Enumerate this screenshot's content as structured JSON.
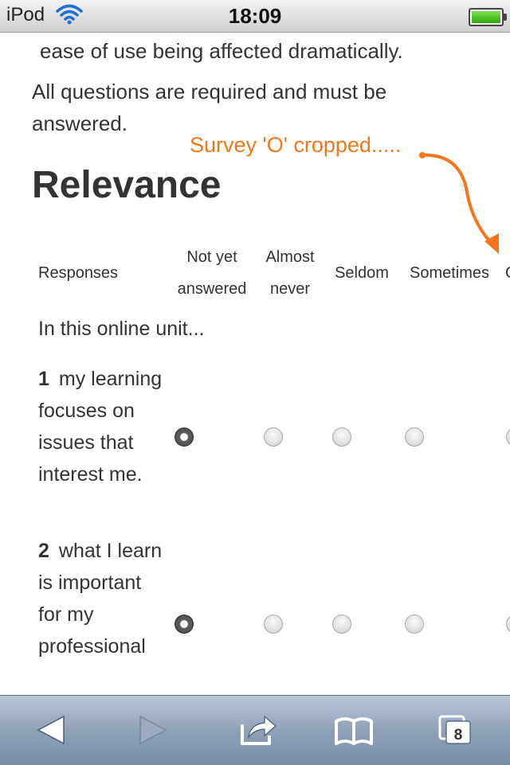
{
  "status_bar": {
    "device": "iPod",
    "time": "18:09"
  },
  "page": {
    "paragraph1_tail": "ease of use being affected dramatically.",
    "paragraph2": "All questions are required and must be answered.",
    "section_heading": "Relevance",
    "annotation": "Survey 'O' cropped.....",
    "annotation_color": "#f5761a",
    "table": {
      "row_header": "Responses",
      "columns": [
        "Not yet answered",
        "Almost never",
        "Seldom",
        "Sometimes",
        "O"
      ],
      "intro": "In this online unit...",
      "questions": [
        {
          "number": "1",
          "text": "my learning focuses on issues that interest me.",
          "selected": "Not yet answered"
        },
        {
          "number": "2",
          "text": "what I learn is important for my professional",
          "selected": "Not yet answered"
        }
      ]
    }
  },
  "toolbar": {
    "back_icon": "back-arrow-icon",
    "forward_icon": "forward-arrow-icon",
    "share_icon": "share-icon",
    "bookmarks_icon": "bookmarks-icon",
    "tabs_icon": "tabs-icon",
    "tabs_count": "8"
  }
}
